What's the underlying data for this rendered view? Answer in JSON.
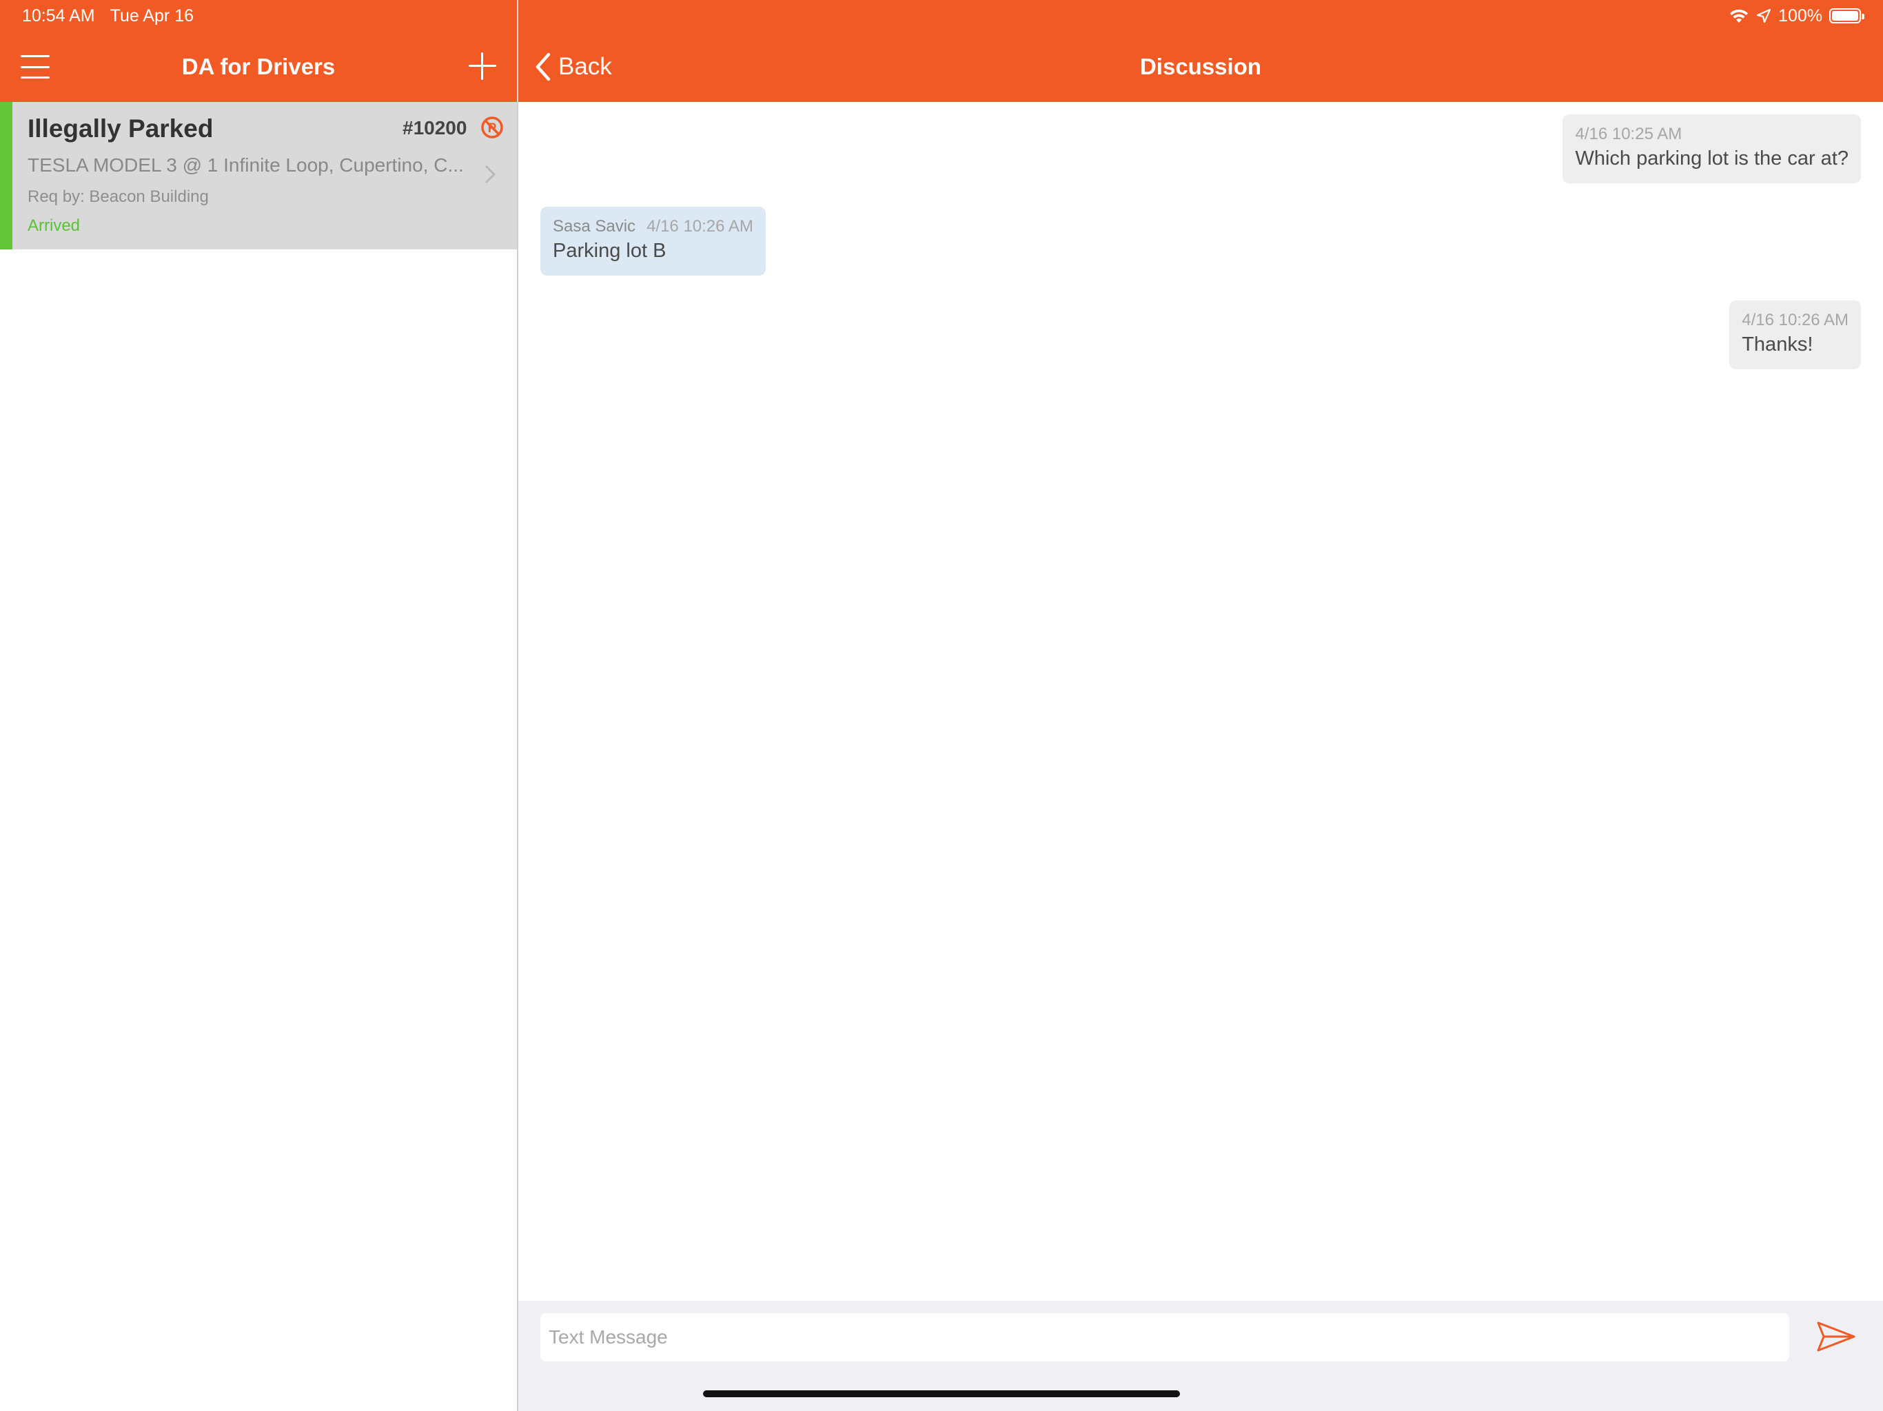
{
  "status_bar": {
    "time": "10:54 AM",
    "date": "Tue Apr 16",
    "battery": "100%",
    "icons": [
      "wifi-icon",
      "location-arrow-icon",
      "battery-icon"
    ]
  },
  "master": {
    "title": "DA for Drivers",
    "menu_icon": "hamburger-menu-icon",
    "add_icon": "plus-icon",
    "jobs": [
      {
        "title": "Illegally Parked",
        "number": "#10200",
        "icon": "no-parking-icon",
        "description": "TESLA MODEL 3 @ 1 Infinite Loop, Cupertino, C...",
        "requested_by": "Req by: Beacon Building",
        "status": "Arrived",
        "accent_color": "#62c53a",
        "status_color": "#5cc03a"
      }
    ]
  },
  "detail": {
    "back_label": "Back",
    "title": "Discussion",
    "messages": [
      {
        "direction": "outgoing",
        "sender": "",
        "timestamp": "4/16 10:25 AM",
        "text": "Which parking lot is the car at?"
      },
      {
        "direction": "incoming",
        "sender": "Sasa Savic",
        "timestamp": "4/16 10:26 AM",
        "text": "Parking lot B"
      },
      {
        "direction": "outgoing",
        "sender": "",
        "timestamp": "4/16 10:26 AM",
        "text": "Thanks!"
      }
    ]
  },
  "composer": {
    "placeholder": "Text Message",
    "value": "",
    "send_icon": "send-icon"
  },
  "colors": {
    "brand": "#f15a24",
    "outgoing_bubble": "#eeeeee",
    "incoming_bubble": "#dce9f5"
  }
}
